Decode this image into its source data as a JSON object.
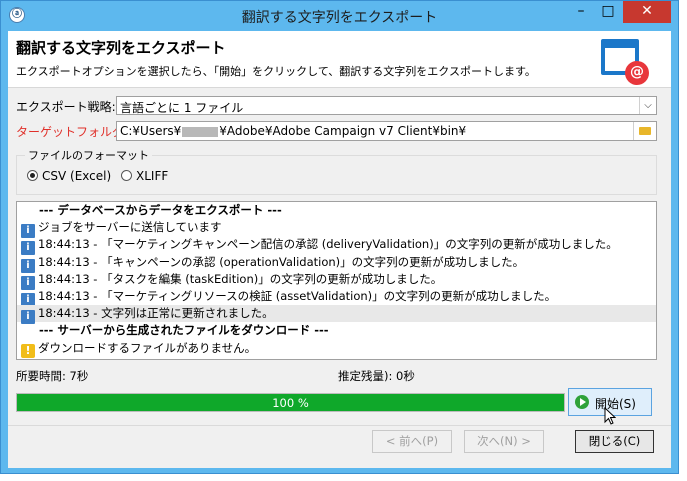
{
  "window": {
    "title": "翻訳する文字列をエクスポート",
    "app_icon_glyph": "ⓐ",
    "minimize_glyph": "–",
    "maximize_glyph": "□",
    "close_glyph": "✕",
    "close_color": "#c7382f"
  },
  "header": {
    "title": "翻訳する文字列をエクスポート",
    "description": "エクスポートオプションを選択したら、「開始」をクリックして、翻訳する文字列をエクスポートします。",
    "logo_glyph": "@"
  },
  "export_strategy": {
    "label": "エクスポート戦略:",
    "value": "言語ごとに 1 ファイル"
  },
  "target_folder": {
    "label": "ターゲットフォルダー:",
    "label_color": "#e0302a",
    "value_prefix": "C:¥Users¥",
    "value_suffix": "¥Adobe¥Adobe Campaign v7 Client¥bin¥"
  },
  "file_format": {
    "legend": "ファイルのフォーマット",
    "options": [
      {
        "label": "CSV (Excel)",
        "selected": true
      },
      {
        "label": "XLIFF",
        "selected": false
      }
    ]
  },
  "log": {
    "lines": [
      {
        "kind": "header",
        "text": "--- データベースからデータをエクスポート ---"
      },
      {
        "kind": "info",
        "text": "ジョブをサーバーに送信しています"
      },
      {
        "kind": "info",
        "text": "18:44:13 - 「マーケティングキャンペーン配信の承認 (deliveryValidation)」の文字列の更新が成功しました。"
      },
      {
        "kind": "info",
        "text": "18:44:13 - 「キャンペーンの承認 (operationValidation)」の文字列の更新が成功しました。"
      },
      {
        "kind": "info",
        "text": "18:44:13 - 「タスクを編集 (taskEdition)」の文字列の更新が成功しました。"
      },
      {
        "kind": "info",
        "text": "18:44:13 - 「マーケティングリソースの検証 (assetValidation)」の文字列の更新が成功しました。"
      },
      {
        "kind": "info",
        "text": "18:44:13 - 文字列は正常に更新されました。",
        "highlight": true
      },
      {
        "kind": "header",
        "text": "--- サーバーから生成されたファイルをダウンロード ---"
      },
      {
        "kind": "warning",
        "text": "ダウンロードするファイルがありません。"
      }
    ]
  },
  "timing": {
    "elapsed_label": "所要時間:",
    "elapsed_value": "7秒",
    "remaining_label": "推定残量):",
    "remaining_value": "0秒"
  },
  "progress": {
    "percent": 100,
    "label": "100 %",
    "color": "#0fa82a"
  },
  "start_button": {
    "label": "開始(S)"
  },
  "footer": {
    "back_label": "< 前へ(P)",
    "next_label": "次へ(N) >",
    "close_label": "閉じる(C)"
  }
}
